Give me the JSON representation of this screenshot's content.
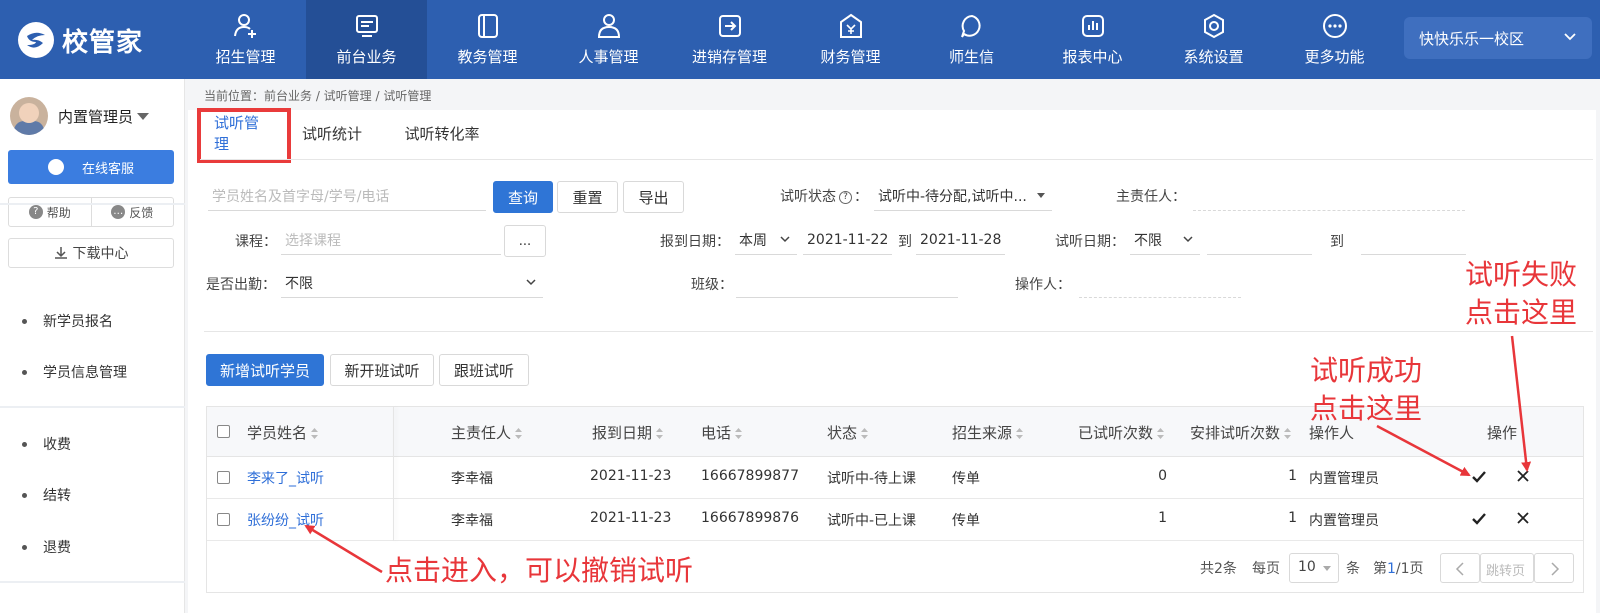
{
  "app": {
    "logo_text": "校管家"
  },
  "nav": [
    {
      "label": "招生管理",
      "icon": "user-add-icon"
    },
    {
      "label": "前台业务",
      "icon": "monitor-icon",
      "active": true
    },
    {
      "label": "教务管理",
      "icon": "book-icon"
    },
    {
      "label": "人事管理",
      "icon": "person-icon"
    },
    {
      "label": "进销存管理",
      "icon": "inventory-icon"
    },
    {
      "label": "财务管理",
      "icon": "money-bag-icon"
    },
    {
      "label": "师生信",
      "icon": "chat-icon"
    },
    {
      "label": "报表中心",
      "icon": "report-icon"
    },
    {
      "label": "系统设置",
      "icon": "settings-icon"
    },
    {
      "label": "更多功能",
      "icon": "more-icon"
    }
  ],
  "campus": {
    "label": "快快乐乐一校区"
  },
  "sidebar": {
    "username": "内置管理员",
    "service_label": "在线客服",
    "help_label": "帮助",
    "feedback_label": "反馈",
    "download_label": "下载中心",
    "items": [
      "新学员报名",
      "学员信息管理",
      "收费",
      "结转",
      "退费"
    ]
  },
  "breadcrumb": "当前位置：前台业务 / 试听管理 / 试听管理",
  "tabs": [
    "试听管理",
    "试听统计",
    "试听转化率"
  ],
  "filters": {
    "search_placeholder": "学员姓名及首字母/学号/电话",
    "query_label": "查询",
    "reset_label": "重置",
    "export_label": "导出",
    "status_label": "试听状态",
    "status_value": "试听中-待分配,试听中...",
    "owner_label": "主责任人：",
    "course_label": "课程：",
    "course_placeholder": "选择课程",
    "more_label": "...",
    "report_date_label": "报到日期：",
    "report_range": "本周",
    "date_from": "2021-11-22",
    "to1": "到",
    "date_to": "2021-11-28",
    "trial_date_label": "试听日期：",
    "trial_range": "不限",
    "to2": "到",
    "attend_label": "是否出勤：",
    "attend_value": "不限",
    "class_label": "班级：",
    "operator_label": "操作人："
  },
  "actions": {
    "add_label": "新增试听学员",
    "new_class_label": "新开班试听",
    "follow_label": "跟班试听"
  },
  "table": {
    "headers": [
      "学员姓名",
      "主责任人",
      "报到日期",
      "电话",
      "状态",
      "招生来源",
      "已试听次数",
      "安排试听次数",
      "操作人",
      "操作"
    ],
    "rows": [
      {
        "name": "李来了_试听",
        "owner": "李幸福",
        "date": "2021-11-23",
        "phone": "16667899877",
        "status": "试听中-待上课",
        "source": "传单",
        "tried": "0",
        "scheduled": "1",
        "operator": "内置管理员"
      },
      {
        "name": "张纷纷_试听",
        "owner": "李幸福",
        "date": "2021-11-23",
        "phone": "16667899876",
        "status": "试听中-已上课",
        "source": "传单",
        "tried": "1",
        "scheduled": "1",
        "operator": "内置管理员"
      }
    ]
  },
  "pager": {
    "total": "共2条",
    "per_page_label": "每页",
    "per_page": "10",
    "unit": "条",
    "page_prefix": "第",
    "page_current": "1",
    "page_rest": "/1页",
    "jump_label": "跳转页"
  },
  "annotations": {
    "fail_line1": "试听失败",
    "fail_line2": "点击这里",
    "success_line1": "试听成功",
    "success_line2": "点击这里",
    "cancel_text": "点击进入，可以撤销试听"
  },
  "colors": {
    "primary": "#2f75d6",
    "topbar": "#2d5fb0",
    "annotation": "#e8363a"
  }
}
